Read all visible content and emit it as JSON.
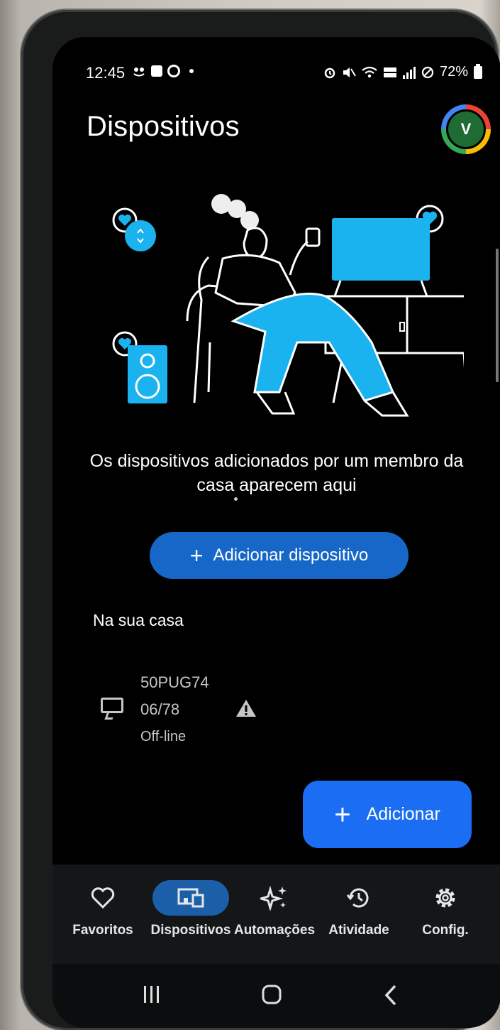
{
  "status_bar": {
    "time": "12:45",
    "battery": "72%"
  },
  "header": {
    "title": "Dispositivos",
    "avatar_initial": "V"
  },
  "empty_state": {
    "message": "Os dispositivos adicionados por um membro da casa aparecem aqui",
    "add_device_label": "Adicionar dispositivo"
  },
  "home_section": {
    "title": "Na sua casa",
    "devices": [
      {
        "name_line1": "50PUG74",
        "name_line2": "06/78",
        "status": "Off-line",
        "icon": "tv-icon",
        "warning_icon": "warning-icon"
      }
    ]
  },
  "fab": {
    "label": "Adicionar"
  },
  "bottom_nav": {
    "items": [
      {
        "label": "Favoritos",
        "icon": "heart-icon",
        "active": false
      },
      {
        "label": "Dispositivos",
        "icon": "devices-icon",
        "active": true
      },
      {
        "label": "Automações",
        "icon": "sparkle-icon",
        "active": false
      },
      {
        "label": "Atividade",
        "icon": "history-icon",
        "active": false
      },
      {
        "label": "Config.",
        "icon": "gear-icon",
        "active": false
      }
    ]
  },
  "colors": {
    "accent": "#1b6ef3",
    "button_blue": "#1667c7",
    "illustration_blue": "#1ab2ef",
    "active_nav": "#1b5fa8"
  }
}
